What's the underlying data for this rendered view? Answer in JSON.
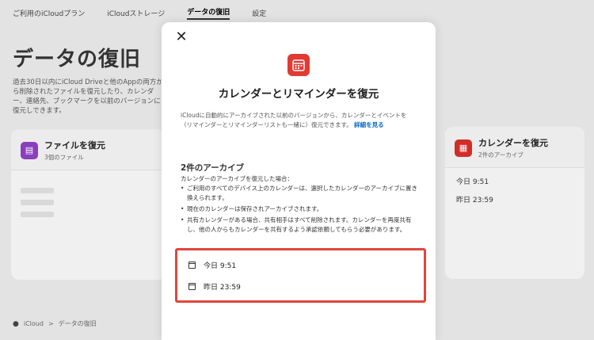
{
  "topnav": {
    "tabs": [
      {
        "label": "ご利用のiCloudプラン"
      },
      {
        "label": "iCloudストレージ"
      },
      {
        "label": "データの復旧"
      },
      {
        "label": "設定"
      }
    ]
  },
  "page": {
    "title": "データの復旧",
    "description": "過去30日以内にiCloud Driveと他のAppの両方から削除されたファイルを復元したり、カレンダー、連絡先、ブックマークを以前のバージョンに復元しできます。"
  },
  "files_card": {
    "title": "ファイルを復元",
    "subtitle": "3個のファイル"
  },
  "calendar_card": {
    "title": "カレンダーを復元",
    "subtitle": "2件のアーカイブ",
    "items": [
      "今日 9:51",
      "昨日 23:59"
    ]
  },
  "breadcrumb": {
    "root": "iCloud",
    "separator": ">",
    "current": "データの復旧"
  },
  "modal": {
    "close_glyph": "✕",
    "title": "カレンダーとリマインダーを復元",
    "description": "iCloudに自動的にアーカイブされた以前のバージョンから、カレンダーとイベントを（リマインダーとリマインダーリストも一緒に）復元できます。",
    "more_link": "詳細を見る",
    "archive_title": "2件のアーカイブ",
    "archive_intro": "カレンダーのアーカイブを復元した場合：",
    "bullets": [
      "ご利用のすべてのデバイス上のカレンダーは、選択したカレンダーのアーカイブに置き換えられます。",
      "現在のカレンダーは保存されアーカイブされます。",
      "共有カレンダーがある場合、共有相手はすべて削除されます。カレンダーを再度共有し、他の人からもカレンダーを共有するよう承認依頼してもらう必要があります。"
    ],
    "archives": [
      {
        "label": "今日 9:51"
      },
      {
        "label": "昨日 23:59"
      }
    ],
    "highlight_color": "#e0463a",
    "icon_color": "#e23a33"
  }
}
